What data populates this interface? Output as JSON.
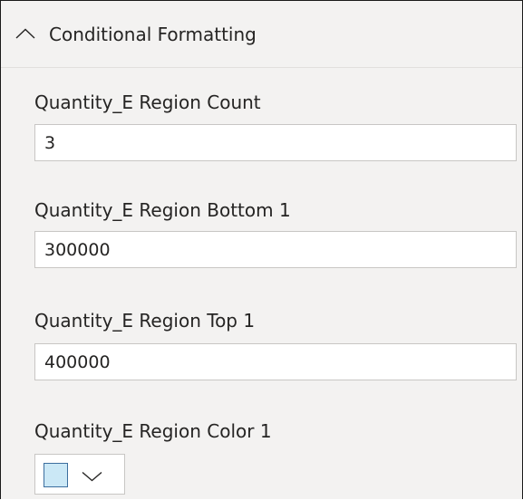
{
  "section": {
    "title": "Conditional Formatting",
    "expanded": true,
    "toggle_icon": "chevron-up-icon"
  },
  "fields": {
    "region_count": {
      "label": "Quantity_E Region Count",
      "value": "3"
    },
    "region_bottom_1": {
      "label": "Quantity_E Region Bottom 1",
      "value": "300000"
    },
    "region_top_1": {
      "label": "Quantity_E Region Top 1",
      "value": "400000"
    },
    "region_color_1": {
      "label": "Quantity_E Region Color 1",
      "color": "#cbe8f6",
      "dropdown_icon": "chevron-down-icon"
    }
  },
  "colors": {
    "panel_background": "#f3f2f1",
    "text": "#252423",
    "input_border": "#c8c6c4"
  }
}
